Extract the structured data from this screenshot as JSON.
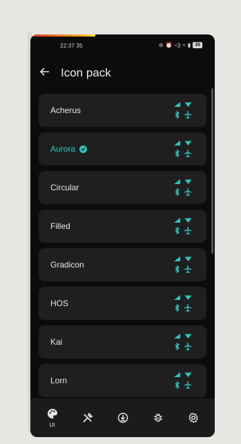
{
  "status": {
    "time": "22:37 35",
    "battery": "35"
  },
  "header": {
    "title": "Icon pack"
  },
  "packs": [
    {
      "label": "Acherus",
      "selected": false
    },
    {
      "label": "Aurora",
      "selected": true
    },
    {
      "label": "Circular",
      "selected": false
    },
    {
      "label": "Filled",
      "selected": false
    },
    {
      "label": "Gradicon",
      "selected": false
    },
    {
      "label": "HOS",
      "selected": false
    },
    {
      "label": "Kai",
      "selected": false
    },
    {
      "label": "Lorn",
      "selected": false
    }
  ],
  "nav": {
    "ui_label": "UI"
  },
  "colors": {
    "accent": "#2ec6c1",
    "row_bg": "#1f1f1f",
    "screen_bg": "#0c0c0c"
  },
  "icons": [
    "back-arrow-icon",
    "signal-icon",
    "wifi-icon",
    "bluetooth-icon",
    "airplane-icon",
    "palette-icon",
    "tools-icon",
    "download-icon",
    "bug-icon",
    "gear-icon",
    "check-icon"
  ]
}
